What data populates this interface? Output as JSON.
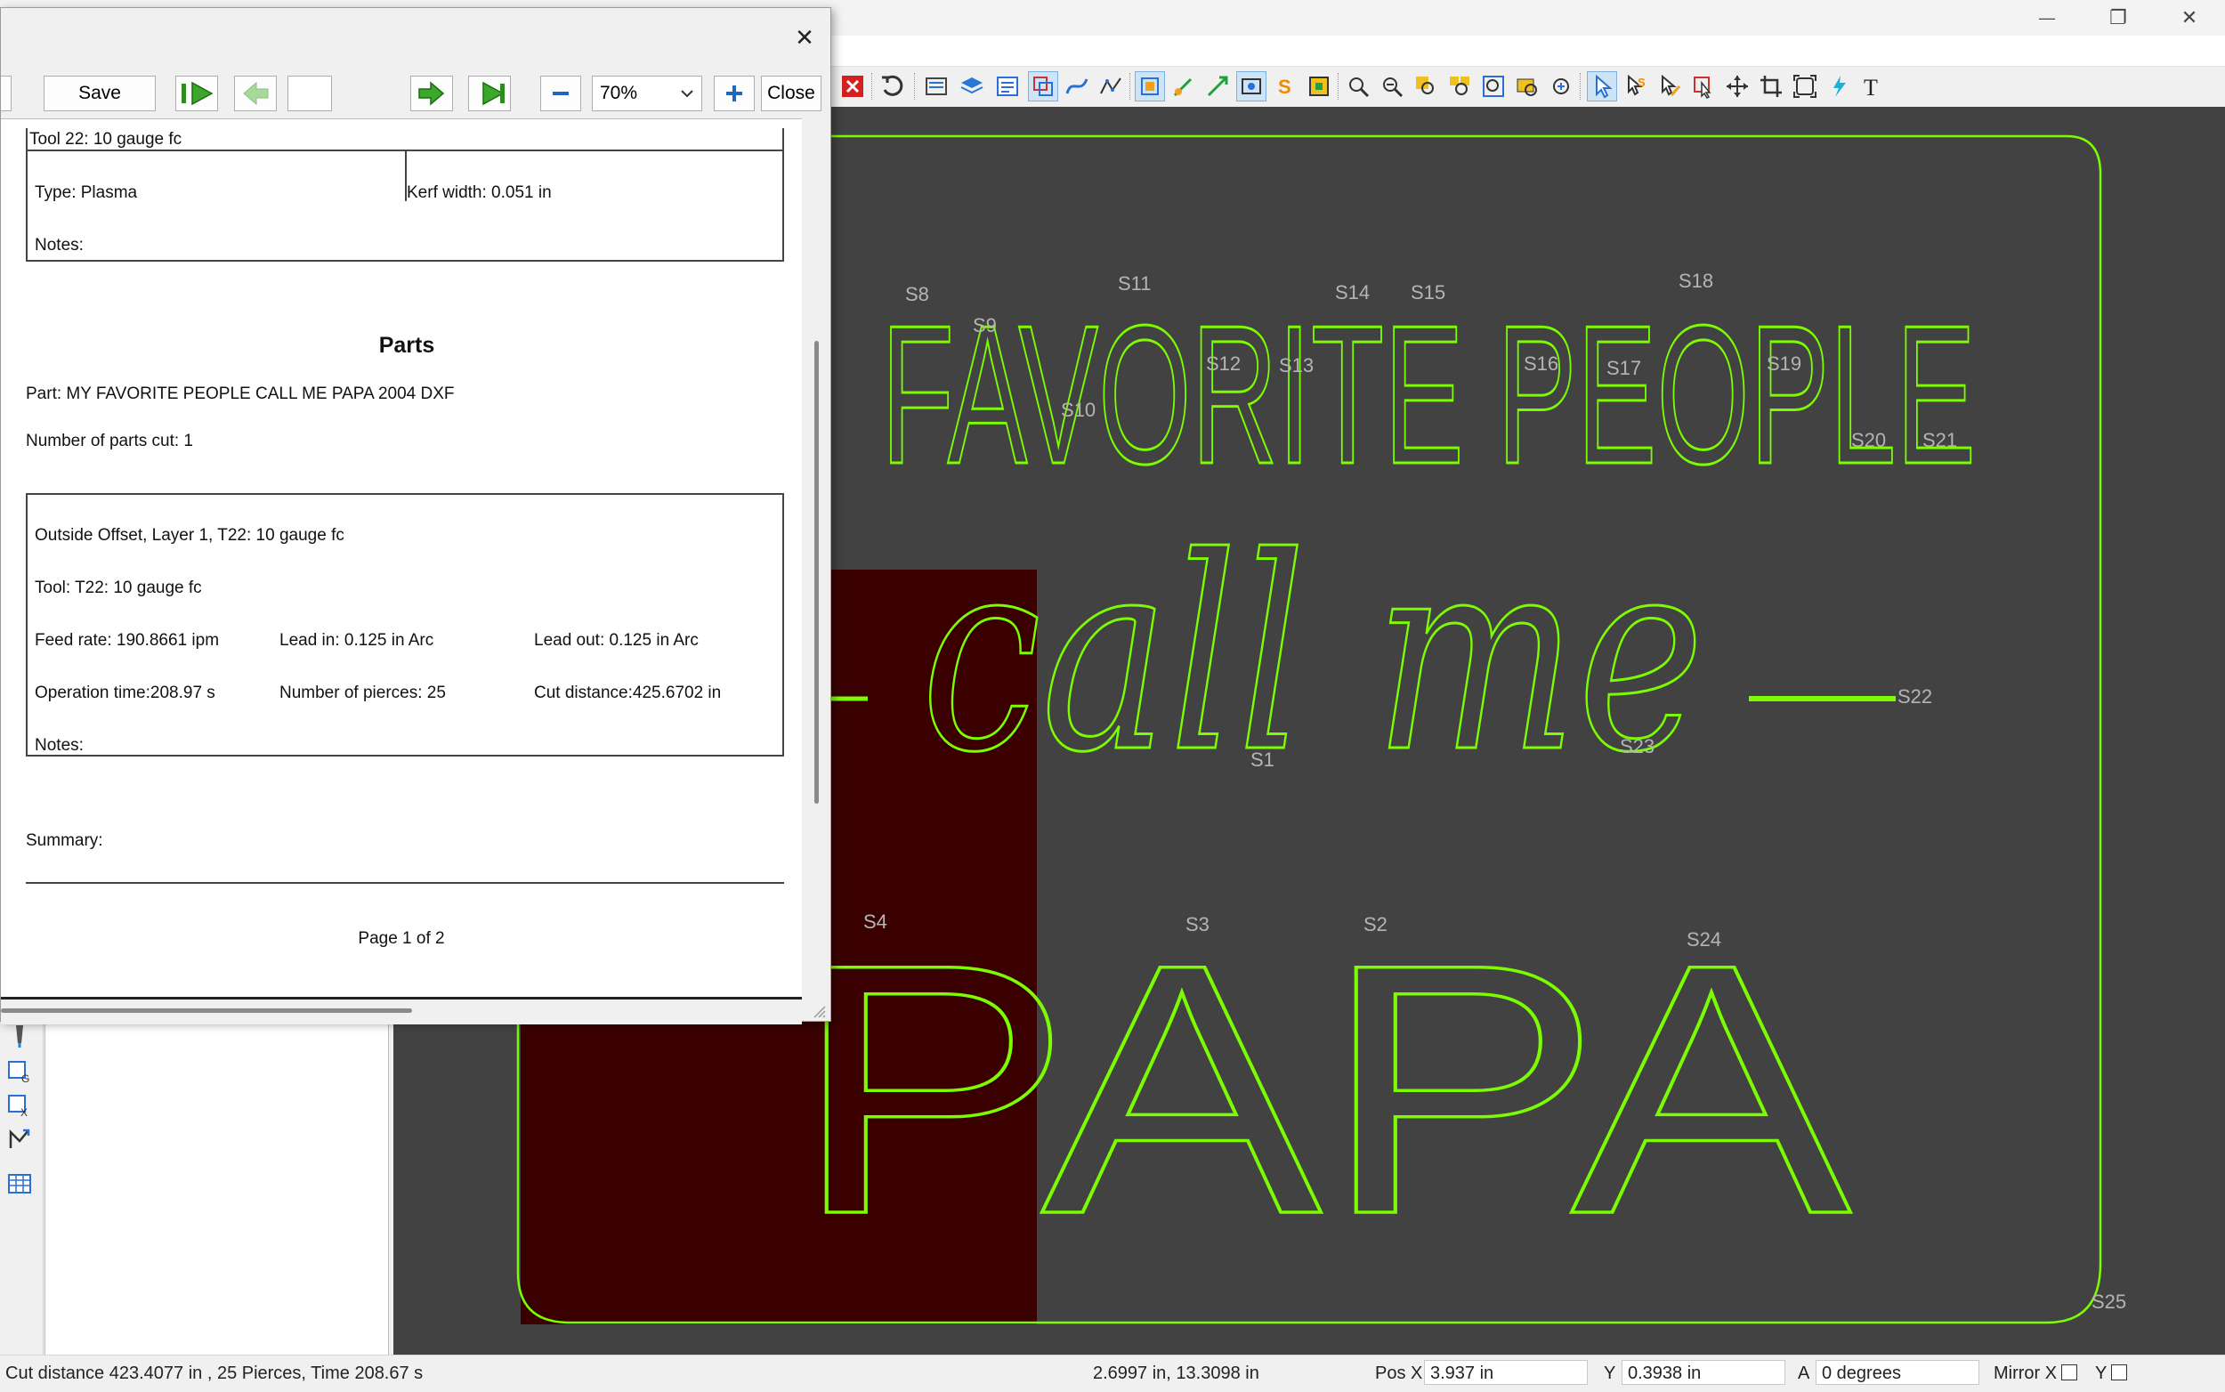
{
  "window": {
    "minimize": "—",
    "maximize": "❐",
    "close": "✕"
  },
  "dialog": {
    "close_glyph": "✕",
    "toolbar": {
      "save_label": "Save",
      "page_input": "",
      "zoom_value": "70%",
      "zoom_options": [
        "70%"
      ],
      "close_label": "Close"
    },
    "report": {
      "tool_header": "Tool 22: 10 gauge fc",
      "tool_type": "Type: Plasma",
      "kerf_width": "Kerf width: 0.051 in",
      "tool_notes": "Notes:",
      "parts_heading": "Parts",
      "part_name": "Part: MY FAVORITE PEOPLE CALL ME PAPA 2004 DXF",
      "parts_cut": "Number of parts cut: 1",
      "op_title": "Outside Offset, Layer 1, T22: 10 gauge fc",
      "op_tool": "Tool: T22: 10 gauge fc",
      "feed_rate": "Feed rate: 190.8661 ipm",
      "lead_in": "Lead in: 0.125 in Arc",
      "lead_out": "Lead out: 0.125 in Arc",
      "op_time": "Operation time:208.97 s",
      "pierces": "Number of pierces: 25",
      "cut_distance": "Cut distance:425.6702 in",
      "op_notes": "Notes:",
      "summary": "Summary:",
      "page_label": "Page 1 of 2"
    }
  },
  "canvas": {
    "line1": "FAVORITE PEOPLE",
    "line2": "call me",
    "line3": "PAPA",
    "start_labels": [
      "S1",
      "S2",
      "S3",
      "S4",
      "S8",
      "S9",
      "S10",
      "S11",
      "S12",
      "S13",
      "S14",
      "S15",
      "S16",
      "S17",
      "S18",
      "S19",
      "S20",
      "S21",
      "S22",
      "S23",
      "S24",
      "S25"
    ],
    "colors": {
      "background": "#424242",
      "cut_path": "#7CFC00",
      "selected_region": "#3a0000",
      "label": "#b5b5b5"
    }
  },
  "status": {
    "summary": "Cut distance 423.4077 in , 25 Pierces, Time 208.67 s",
    "cursor_coords": "2.6997 in, 13.3098 in",
    "pos_x_label": "Pos X",
    "pos_x_value": "3.937 in",
    "y_label": "Y",
    "y_value": "0.3938 in",
    "a_label": "A",
    "a_value": "0 degrees",
    "mirror_x_label": "Mirror X",
    "mirror_y_label": "Y"
  }
}
